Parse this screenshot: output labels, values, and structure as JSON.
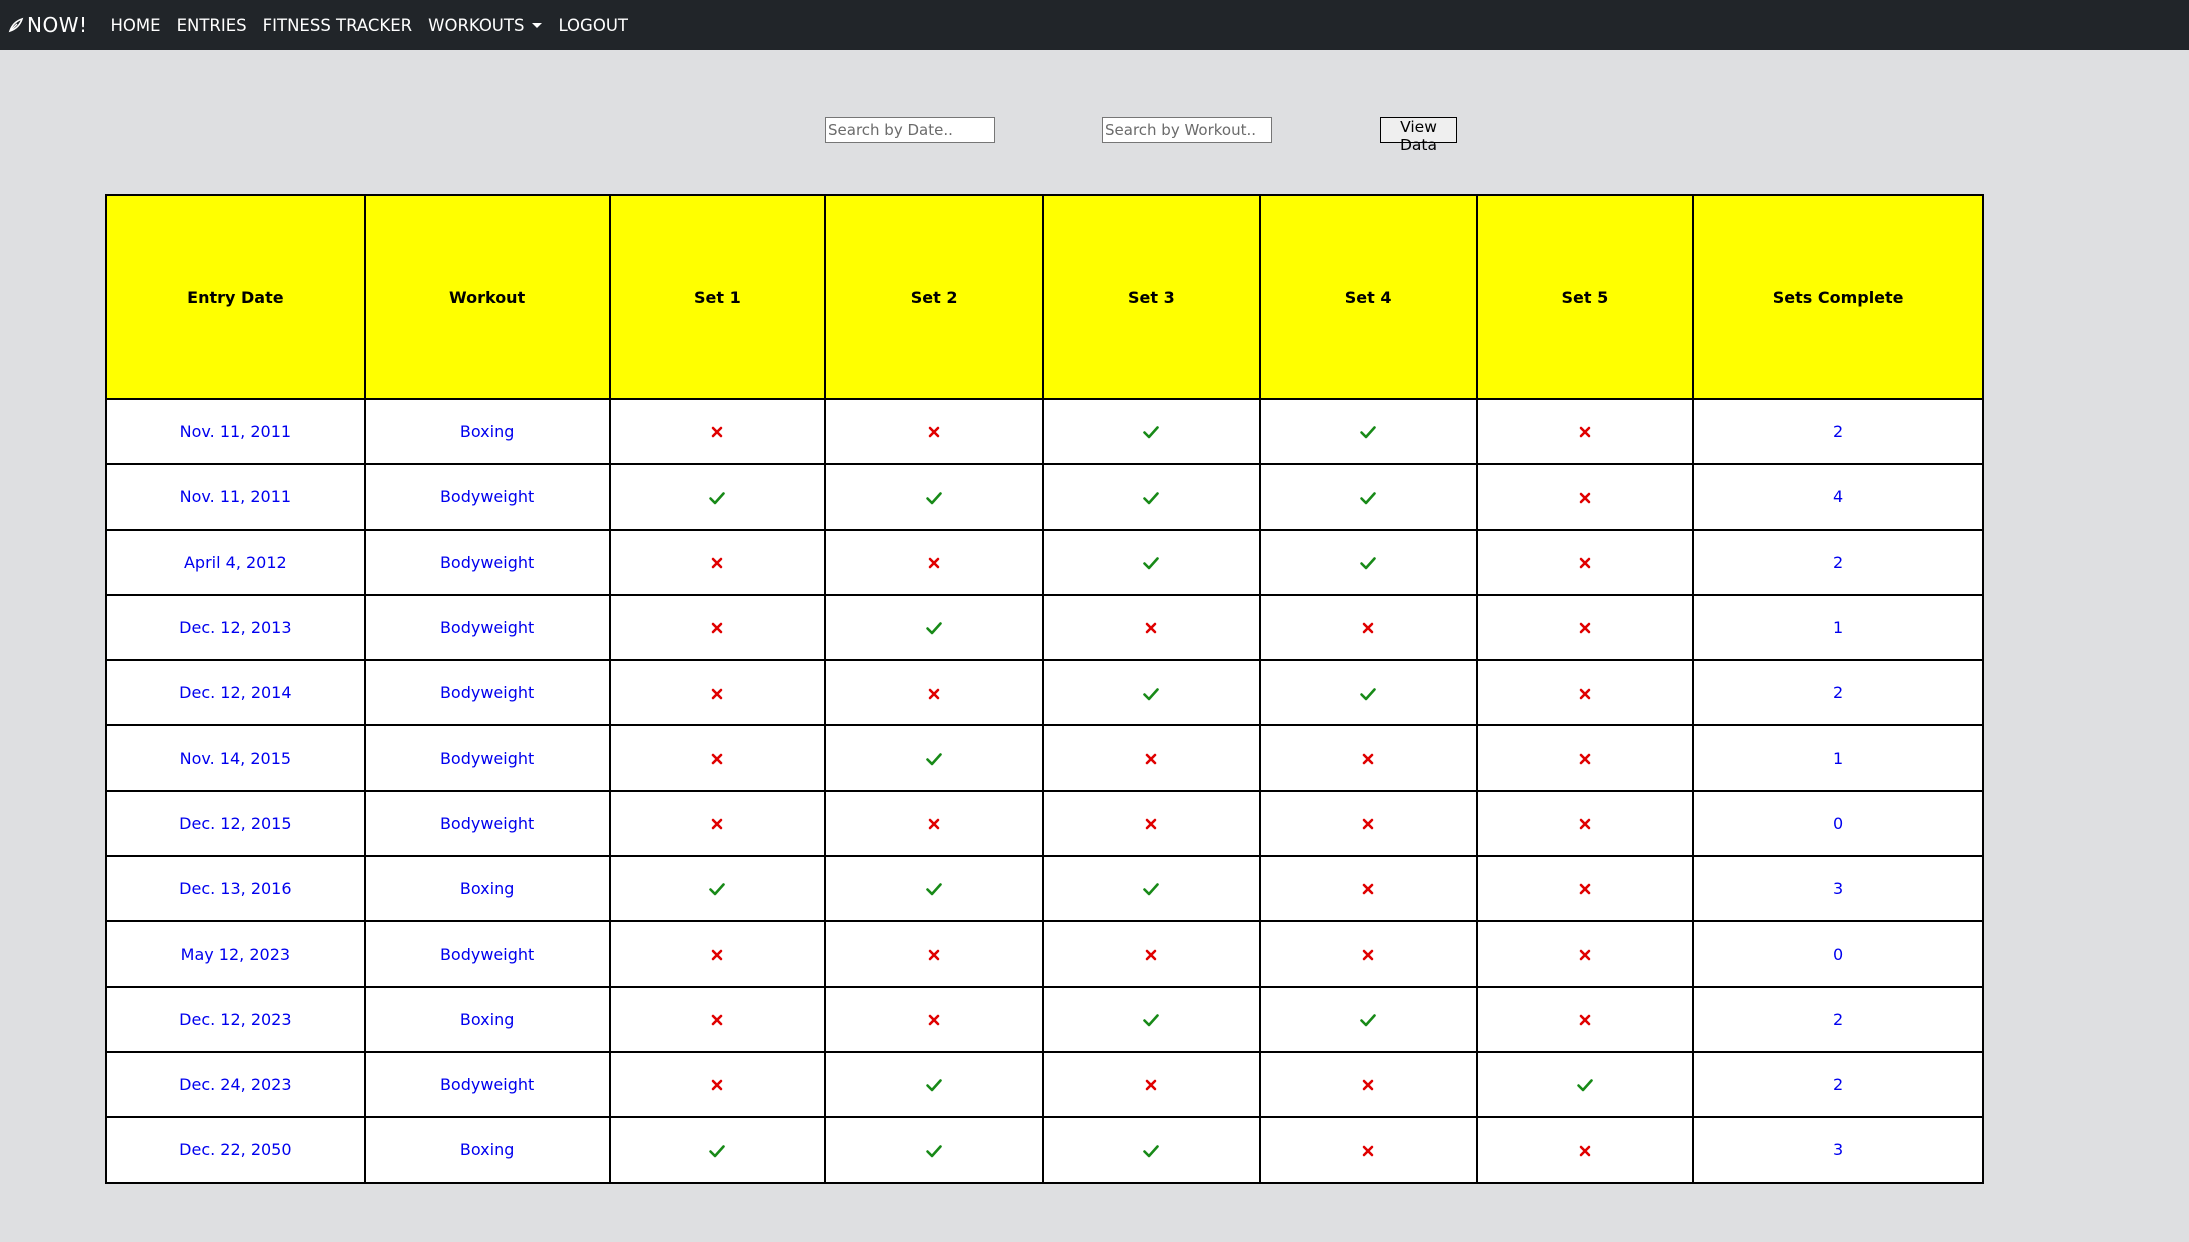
{
  "nav": {
    "brand": "NOW!",
    "links": [
      "HOME",
      "ENTRIES",
      "FITNESS TRACKER",
      "WORKOUTS",
      "LOGOUT"
    ]
  },
  "search": {
    "date_placeholder": "Search by Date..",
    "workout_placeholder": "Search by Workout..",
    "button_label": "View Data"
  },
  "colors": {
    "navbar": "#212529",
    "header_bg": "#ffff00",
    "link_text": "#0000ee",
    "check": "#188a18",
    "cross": "#e00000"
  },
  "table": {
    "headers": [
      "Entry Date",
      "Workout",
      "Set 1",
      "Set 2",
      "Set 3",
      "Set 4",
      "Set 5",
      "Sets Complete"
    ],
    "rows": [
      {
        "date": "Nov. 11, 2011",
        "workout": "Boxing",
        "sets": [
          false,
          false,
          true,
          true,
          false
        ],
        "complete": "2"
      },
      {
        "date": "Nov. 11, 2011",
        "workout": "Bodyweight",
        "sets": [
          true,
          true,
          true,
          true,
          false
        ],
        "complete": "4"
      },
      {
        "date": "April 4, 2012",
        "workout": "Bodyweight",
        "sets": [
          false,
          false,
          true,
          true,
          false
        ],
        "complete": "2"
      },
      {
        "date": "Dec. 12, 2013",
        "workout": "Bodyweight",
        "sets": [
          false,
          true,
          false,
          false,
          false
        ],
        "complete": "1"
      },
      {
        "date": "Dec. 12, 2014",
        "workout": "Bodyweight",
        "sets": [
          false,
          false,
          true,
          true,
          false
        ],
        "complete": "2"
      },
      {
        "date": "Nov. 14, 2015",
        "workout": "Bodyweight",
        "sets": [
          false,
          true,
          false,
          false,
          false
        ],
        "complete": "1"
      },
      {
        "date": "Dec. 12, 2015",
        "workout": "Bodyweight",
        "sets": [
          false,
          false,
          false,
          false,
          false
        ],
        "complete": "0"
      },
      {
        "date": "Dec. 13, 2016",
        "workout": "Boxing",
        "sets": [
          true,
          true,
          true,
          false,
          false
        ],
        "complete": "3"
      },
      {
        "date": "May 12, 2023",
        "workout": "Bodyweight",
        "sets": [
          false,
          false,
          false,
          false,
          false
        ],
        "complete": "0"
      },
      {
        "date": "Dec. 12, 2023",
        "workout": "Boxing",
        "sets": [
          false,
          false,
          true,
          true,
          false
        ],
        "complete": "2"
      },
      {
        "date": "Dec. 24, 2023",
        "workout": "Bodyweight",
        "sets": [
          false,
          true,
          false,
          false,
          true
        ],
        "complete": "2"
      },
      {
        "date": "Dec. 22, 2050",
        "workout": "Boxing",
        "sets": [
          true,
          true,
          true,
          false,
          false
        ],
        "complete": "3"
      }
    ]
  }
}
